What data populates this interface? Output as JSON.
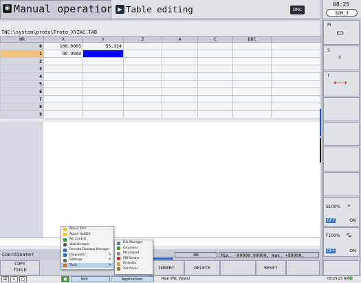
{
  "header": {
    "mode_title": "Manual operation",
    "sub_title": "Table editing",
    "dnc": "DNC",
    "time": "08:25",
    "clock_sub": "SOM_3"
  },
  "path": "TNC:\\system\\proto\\Proto_XYZAC.TAB",
  "table": {
    "columns": [
      "NR",
      "X",
      "Y",
      "Z",
      "A",
      "C",
      "DOC"
    ],
    "rows": [
      {
        "nr": "0",
        "x": "100.0005",
        "y": "55.324"
      },
      {
        "nr": "1",
        "x": "99.9989",
        "y": ""
      },
      {
        "nr": "2",
        "x": "",
        "y": ""
      },
      {
        "nr": "3",
        "x": "",
        "y": ""
      },
      {
        "nr": "4",
        "x": "",
        "y": ""
      },
      {
        "nr": "5",
        "x": "",
        "y": ""
      },
      {
        "nr": "6",
        "x": "",
        "y": ""
      },
      {
        "nr": "7",
        "x": "",
        "y": ""
      },
      {
        "nr": "8",
        "x": "",
        "y": ""
      },
      {
        "nr": "9",
        "x": "",
        "y": ""
      }
    ]
  },
  "status": {
    "coord_label": "Coordinate?",
    "unit": "mm",
    "range": "Min. -99999.99999, max. +99999."
  },
  "softkeys": {
    "copy_field": [
      "COPY",
      "FIELD"
    ],
    "insert": "INSERT",
    "delete": "DELETE",
    "reset": "RESET"
  },
  "menu_main": {
    "items": [
      "About Xfce",
      "About HeROS",
      "NC Control",
      "Web Browser",
      "Remote Desktop Manager",
      "Diagnostic",
      "Settings",
      "Tools"
    ]
  },
  "menu_tools": {
    "items": [
      "File Manager",
      "Gnumeric",
      "Mousepad",
      "PDFViewer",
      "Ristretto",
      "Xarchiver"
    ]
  },
  "taskbar": {
    "edit": "Edit",
    "applications": "Applications",
    "vnc": "Real VNC Viewer",
    "clock": "08:25:23 AM"
  },
  "sidebar": {
    "m": "M",
    "s": "S",
    "t": "T",
    "s_override": "S100%",
    "f_override": "F100%",
    "off": "OFF",
    "on": "ON"
  }
}
